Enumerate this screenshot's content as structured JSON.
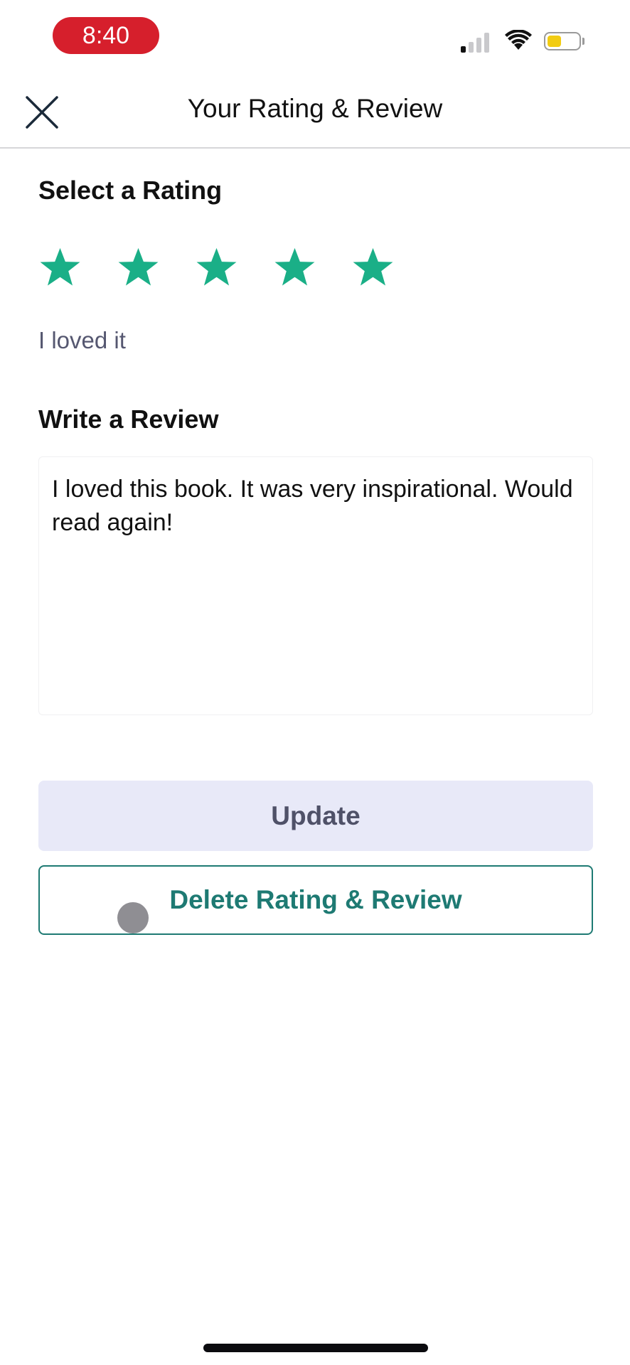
{
  "status_bar": {
    "time": "8:40",
    "signal_bars_active": 1,
    "signal_bars_total": 4,
    "battery_level_fraction": 0.45,
    "battery_color": "#f2cc12",
    "time_pill_color": "#d61f2c"
  },
  "header": {
    "title": "Your Rating & Review",
    "close_icon": "close-icon"
  },
  "rating": {
    "heading": "Select a Rating",
    "value": 5,
    "max": 5,
    "star_color": "#1aaf87",
    "label": "I loved it"
  },
  "review": {
    "heading": "Write a Review",
    "text": "I loved this book. It was very inspirational. Would read again!"
  },
  "buttons": {
    "update_label": "Update",
    "delete_label": "Delete Rating & Review",
    "accent_color": "#1e7a73"
  }
}
